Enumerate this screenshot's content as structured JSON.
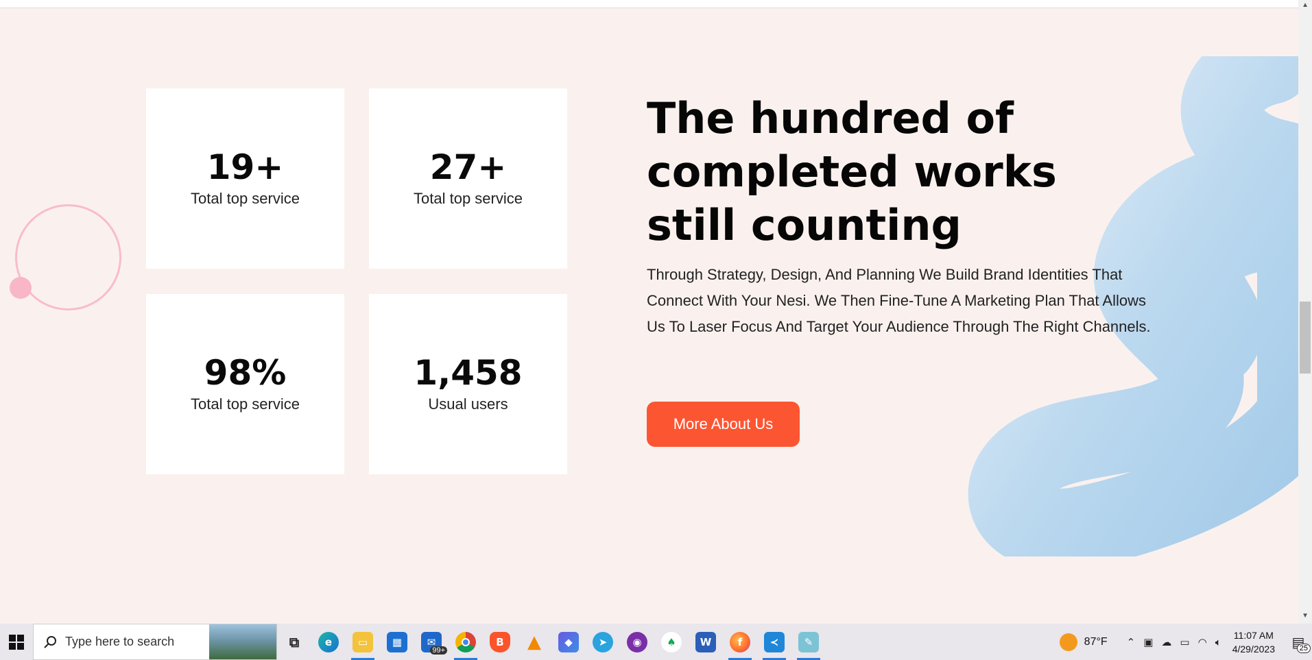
{
  "stats": [
    {
      "value": "19+",
      "label": "Total top service"
    },
    {
      "value": "27+",
      "label": "Total top service"
    },
    {
      "value": "98%",
      "label": "Total top service"
    },
    {
      "value": "1,458",
      "label": "Usual users"
    }
  ],
  "headline": "The hundred of completed works still counting",
  "body": "Through Strategy, Design, And Planning We Build Brand Identities That Connect With Your Nesi. We Then Fine-Tune A Marketing Plan That Allows Us To Laser Focus And Target Your Audience Through The Right Channels.",
  "cta_label": "More About Us",
  "colors": {
    "accent": "#fc5532",
    "background": "#faf1ee",
    "ring": "#f8bccb",
    "blob": "#b7d6ee"
  },
  "taskbar": {
    "search_placeholder": "Type here to search",
    "apps": [
      {
        "name": "task-view-icon",
        "active": false
      },
      {
        "name": "edge-icon",
        "active": false
      },
      {
        "name": "file-explorer-icon",
        "active": true
      },
      {
        "name": "microsoft-store-icon",
        "active": false
      },
      {
        "name": "mail-icon",
        "active": false,
        "badge": "99+"
      },
      {
        "name": "chrome-icon",
        "active": true
      },
      {
        "name": "brave-icon",
        "active": false
      },
      {
        "name": "vlc-icon",
        "active": false
      },
      {
        "name": "copilot-icon",
        "active": false
      },
      {
        "name": "telegram-icon",
        "active": false
      },
      {
        "name": "github-desktop-icon",
        "active": false
      },
      {
        "name": "mongodb-compass-icon",
        "active": false
      },
      {
        "name": "word-icon",
        "active": false
      },
      {
        "name": "firefox-icon",
        "active": true
      },
      {
        "name": "vscode-icon",
        "active": true
      },
      {
        "name": "notepad-icon",
        "active": true
      }
    ],
    "temperature": "87°F",
    "time": "11:07 AM",
    "date": "4/29/2023",
    "notification_count": "25"
  }
}
